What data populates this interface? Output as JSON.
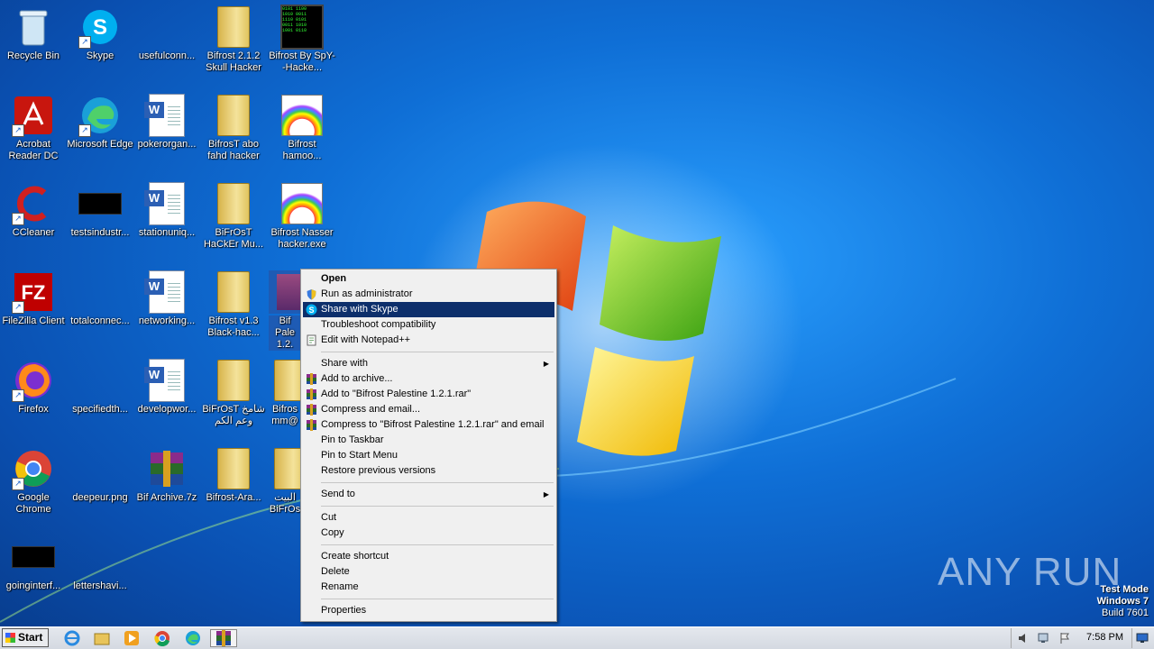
{
  "desktop": {
    "icons": [
      {
        "label": "Recycle Bin"
      },
      {
        "label": "Skype"
      },
      {
        "label": "usefulconn..."
      },
      {
        "label": "Bifrost 2.1.2 Skull Hacker"
      },
      {
        "label": "Bifrost By SpY--Hacke..."
      },
      {
        "label": "Acrobat Reader DC"
      },
      {
        "label": "Microsoft Edge"
      },
      {
        "label": "pokerorgan..."
      },
      {
        "label": "BifrosT abo fahd hacker"
      },
      {
        "label": "Bifrost hamoo..."
      },
      {
        "label": "CCleaner"
      },
      {
        "label": "testsindustr..."
      },
      {
        "label": "stationuniq..."
      },
      {
        "label": "BiFrOsT HaCkEr Mu..."
      },
      {
        "label": "Bifrost Nasser hacker.exe"
      },
      {
        "label": "FileZilla Client"
      },
      {
        "label": "totalconnec..."
      },
      {
        "label": "networking..."
      },
      {
        "label": "Bifrost v1.3 Black-hac..."
      },
      {
        "label": "Bif Pale 1.2."
      },
      {
        "label": "Firefox"
      },
      {
        "label": "specifiedth..."
      },
      {
        "label": "developwor..."
      },
      {
        "label": "BiFrOsT شامخ وعم الكم"
      },
      {
        "label": "Bifros mm@"
      },
      {
        "label": "Google Chrome"
      },
      {
        "label": "deepeur.png"
      },
      {
        "label": "Bif Archive.7z"
      },
      {
        "label": "Bifrost-Ara..."
      },
      {
        "label": "البيت BiFrOs"
      },
      {
        "label": "goinginterf..."
      },
      {
        "label": "lettershavi..."
      }
    ]
  },
  "context_menu": {
    "items": [
      {
        "label": "Open"
      },
      {
        "label": "Run as administrator"
      },
      {
        "label": "Share with Skype"
      },
      {
        "label": "Troubleshoot compatibility"
      },
      {
        "label": "Edit with Notepad++"
      },
      {
        "label": "Share with"
      },
      {
        "label": "Add to archive..."
      },
      {
        "label": "Add to \"Bifrost Palestine 1.2.1.rar\""
      },
      {
        "label": "Compress and email..."
      },
      {
        "label": "Compress to \"Bifrost Palestine 1.2.1.rar\" and email"
      },
      {
        "label": "Pin to Taskbar"
      },
      {
        "label": "Pin to Start Menu"
      },
      {
        "label": "Restore previous versions"
      },
      {
        "label": "Send to"
      },
      {
        "label": "Cut"
      },
      {
        "label": "Copy"
      },
      {
        "label": "Create shortcut"
      },
      {
        "label": "Delete"
      },
      {
        "label": "Rename"
      },
      {
        "label": "Properties"
      }
    ],
    "highlight_color": "#0d2f6b"
  },
  "taskbar": {
    "start_label": "Start",
    "clock": "7:58 PM"
  },
  "watermark": "ANY RUN",
  "test_mode": {
    "line1": "Test Mode",
    "line2": "Windows 7",
    "line3": "Build 7601"
  }
}
